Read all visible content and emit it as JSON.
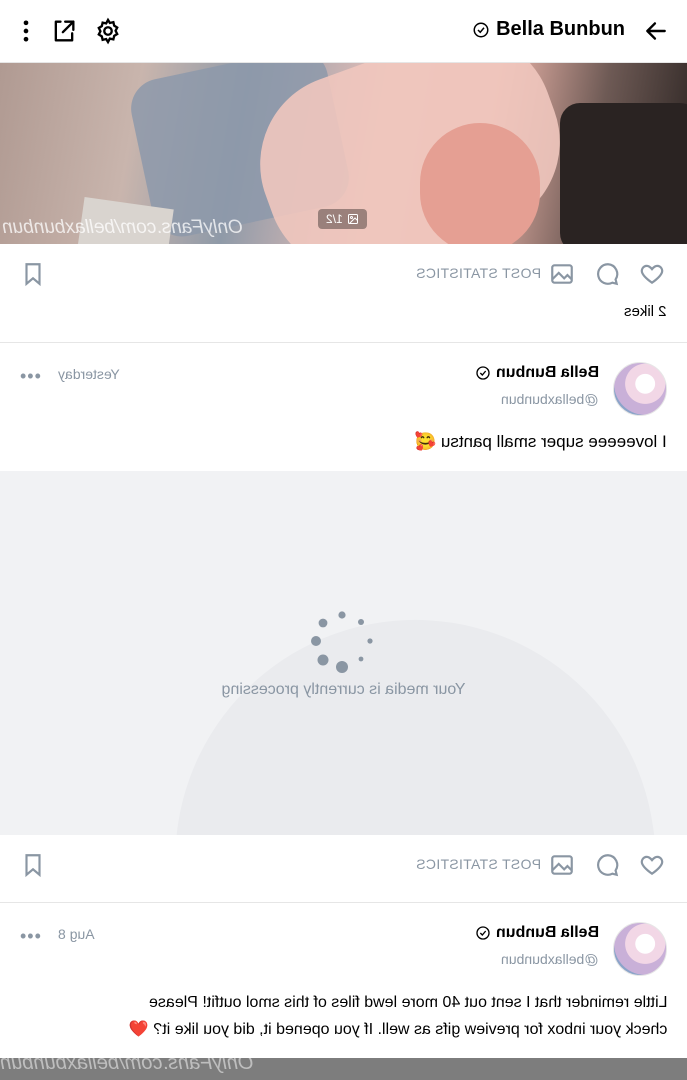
{
  "header": {
    "title": "Bella Bunbun",
    "back_icon": "arrow-left-icon",
    "verified_icon": "verified-badge-icon",
    "icons": [
      "settings-gear-icon",
      "share-icon",
      "more-vertical-icon"
    ]
  },
  "first_post": {
    "watermark": "OnlyFans.com/bellaxbunbun",
    "media_counter": "1/2",
    "post_statistics_label": "POST STATISTICS",
    "likes": "2 likes"
  },
  "second_post": {
    "name": "Bella Bunbun",
    "handle": "@bellaxbunbun",
    "date": "Yesterday",
    "menu": "•••",
    "text": "I loveeeee super small pantsu 🥰",
    "media_status": "Your media is currently processing",
    "post_statistics_label": "POST STATISTICS"
  },
  "third_post": {
    "name": "Bella Bunbun",
    "handle": "@bellaxbunbun",
    "date": "Aug 8",
    "menu": "•••",
    "text_line1": "Little reminder that I sent out 40 more lewd files of this smol outfit! Please",
    "text_line2": "check your inbox for preview gifs as well. If you opened it, did you like it? ❤️",
    "watermark": "OnlyFans.com/bellaxbunbun"
  },
  "colors": {
    "muted": "#8a96a3",
    "divider": "#e6e6e6",
    "media_placeholder": "#f1f2f4"
  }
}
